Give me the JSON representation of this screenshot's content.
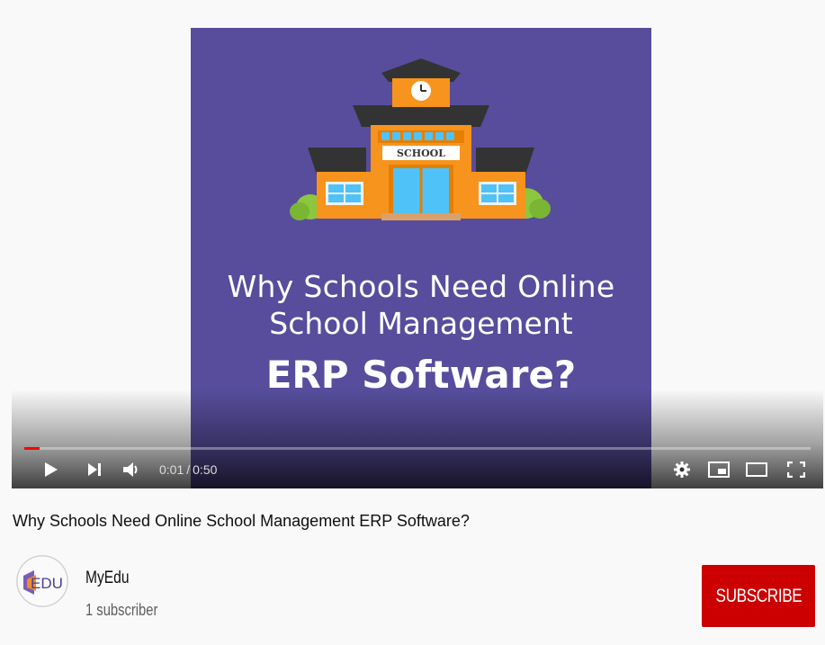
{
  "video": {
    "thumbnail_line1": "Why Schools Need Online",
    "thumbnail_line2": "School Management",
    "thumbnail_line3": "ERP Software?",
    "sign_text": "SCHOOL",
    "title": "Why Schools Need Online School Management ERP Software?"
  },
  "player": {
    "current_time": "0:01",
    "separator": "/",
    "duration": "0:50",
    "progress_fraction": 0.02,
    "controls": {
      "play_icon": "play-icon",
      "next_icon": "next-icon",
      "volume_icon": "volume-icon",
      "settings_icon": "gear-icon",
      "miniplayer_icon": "miniplayer-icon",
      "theater_icon": "theater-icon",
      "fullscreen_icon": "fullscreen-icon"
    }
  },
  "channel": {
    "name": "MyEdu",
    "subscribers": "1 subscriber",
    "avatar_text": "EDU"
  },
  "actions": {
    "subscribe_label": "SUBSCRIBE"
  },
  "colors": {
    "video_bg": "#574d9c",
    "progress": "#ff0000",
    "subscribe_bg": "#cc0000"
  }
}
